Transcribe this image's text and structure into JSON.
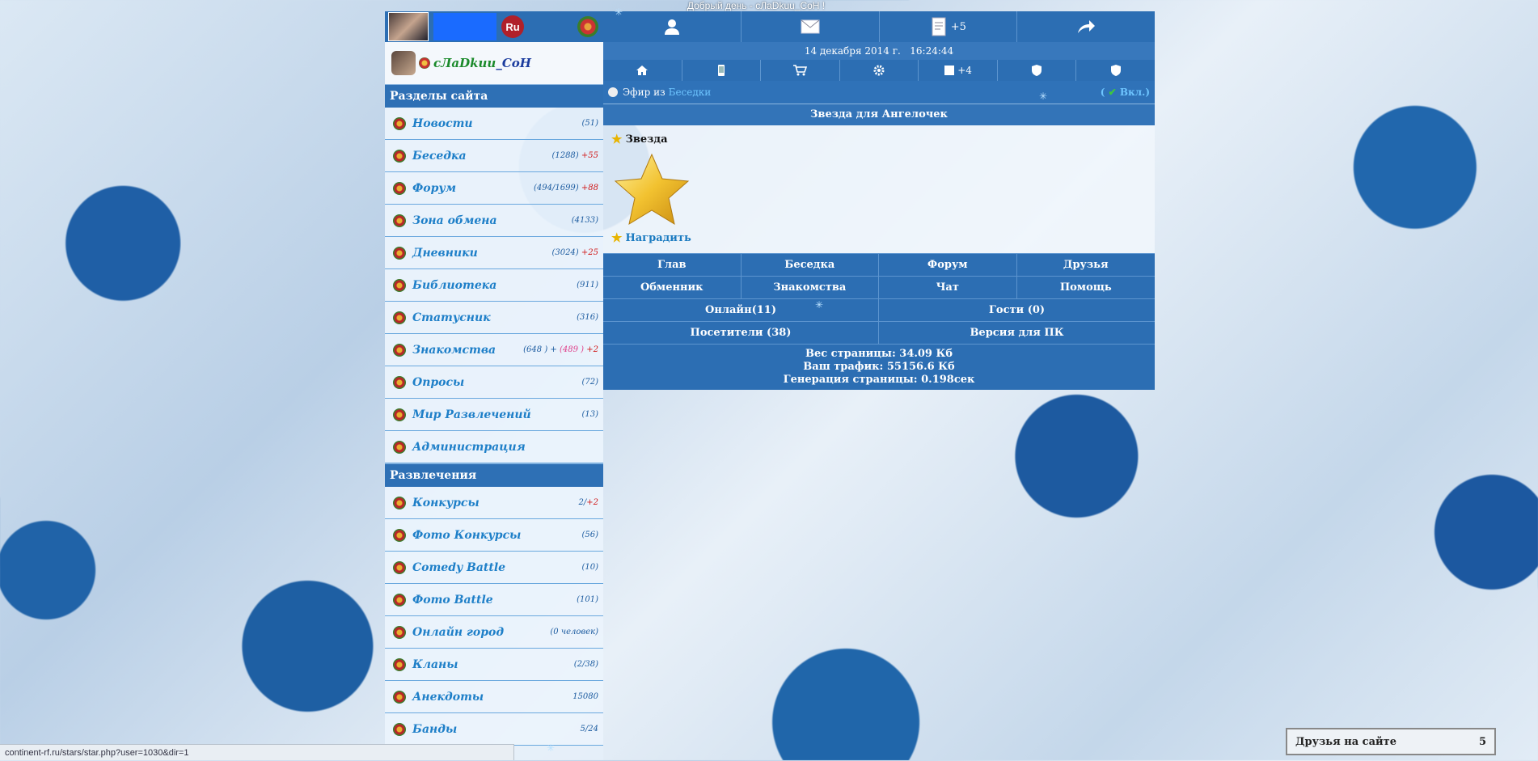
{
  "greeting": "Добрый день - cЛaDkuu_CoH !",
  "status_url": "continent-rf.ru/stars/star.php?user=1030&dir=1",
  "user": {
    "nick_a": "cЛaDkuu",
    "nick_b": "_CoH",
    "badge": "Ru"
  },
  "header": {
    "mail_count": "+5",
    "date": "14 декабря 2014 г.",
    "time": "16:24:44",
    "notes_count": "+4"
  },
  "sections_title": "Разделы сайта",
  "sections": [
    {
      "label": "Новости",
      "count": "(51)",
      "extra": ""
    },
    {
      "label": "Беседка",
      "count": "(1288)",
      "extra": "+55"
    },
    {
      "label": "Форум",
      "count": "(494/1699)",
      "extra": "+88"
    },
    {
      "label": "Зона обмена",
      "count": "(4133)",
      "extra": ""
    },
    {
      "label": "Дневники",
      "count": "(3024)",
      "extra": "+25"
    },
    {
      "label": "Библиотека",
      "count": "(911)",
      "extra": ""
    },
    {
      "label": "Статусник",
      "count": "(316)",
      "extra": ""
    },
    {
      "label": "Знакомства",
      "count": "(648 ) +",
      "pink": "(489 )",
      "extra": "+2"
    },
    {
      "label": "Опросы",
      "count": "(72)",
      "extra": ""
    },
    {
      "label": "Мир Развлечений",
      "count": "(13)",
      "extra": ""
    },
    {
      "label": "Администрация",
      "count": "",
      "extra": ""
    }
  ],
  "fun_title": "Развлечения",
  "fun": [
    {
      "label": "Конкурсы",
      "count": "2/",
      "extra": "+2"
    },
    {
      "label": "Фото Конкурсы",
      "count": "(56)",
      "extra": ""
    },
    {
      "label": "Comedy Battle",
      "count": "(10)",
      "extra": ""
    },
    {
      "label": "Фото Battle",
      "count": "(101)",
      "extra": ""
    },
    {
      "label": "Онлайн город",
      "count": "(0 человек)",
      "extra": ""
    },
    {
      "label": "Кланы",
      "count": "(2/38)",
      "extra": ""
    },
    {
      "label": "Анекдоты",
      "count": "15080",
      "extra": ""
    },
    {
      "label": "Банды",
      "count": "5/24",
      "extra": ""
    }
  ],
  "air": {
    "prefix": "Эфир из",
    "link": "Беседки",
    "toggle": "Вкл.)"
  },
  "page_title": "Звезда для Ангелочек",
  "star_label": "Звезда",
  "reward_label": "Наградить",
  "nav": [
    "Глав",
    "Беседка",
    "Форум",
    "Друзья",
    "Обменник",
    "Знакомства",
    "Чат",
    "Помощь"
  ],
  "nav2": [
    "Онлайн(11)",
    "Гости (0)",
    "Посетители (38)",
    "Версия для ПК"
  ],
  "stats": [
    "Вес страницы: 34.09 Кб",
    "Ваш трафик: 55156.6 Кб",
    "Генерация страницы: 0.198сек"
  ],
  "friends": {
    "label": "Друзья на сайте",
    "count": "5"
  }
}
